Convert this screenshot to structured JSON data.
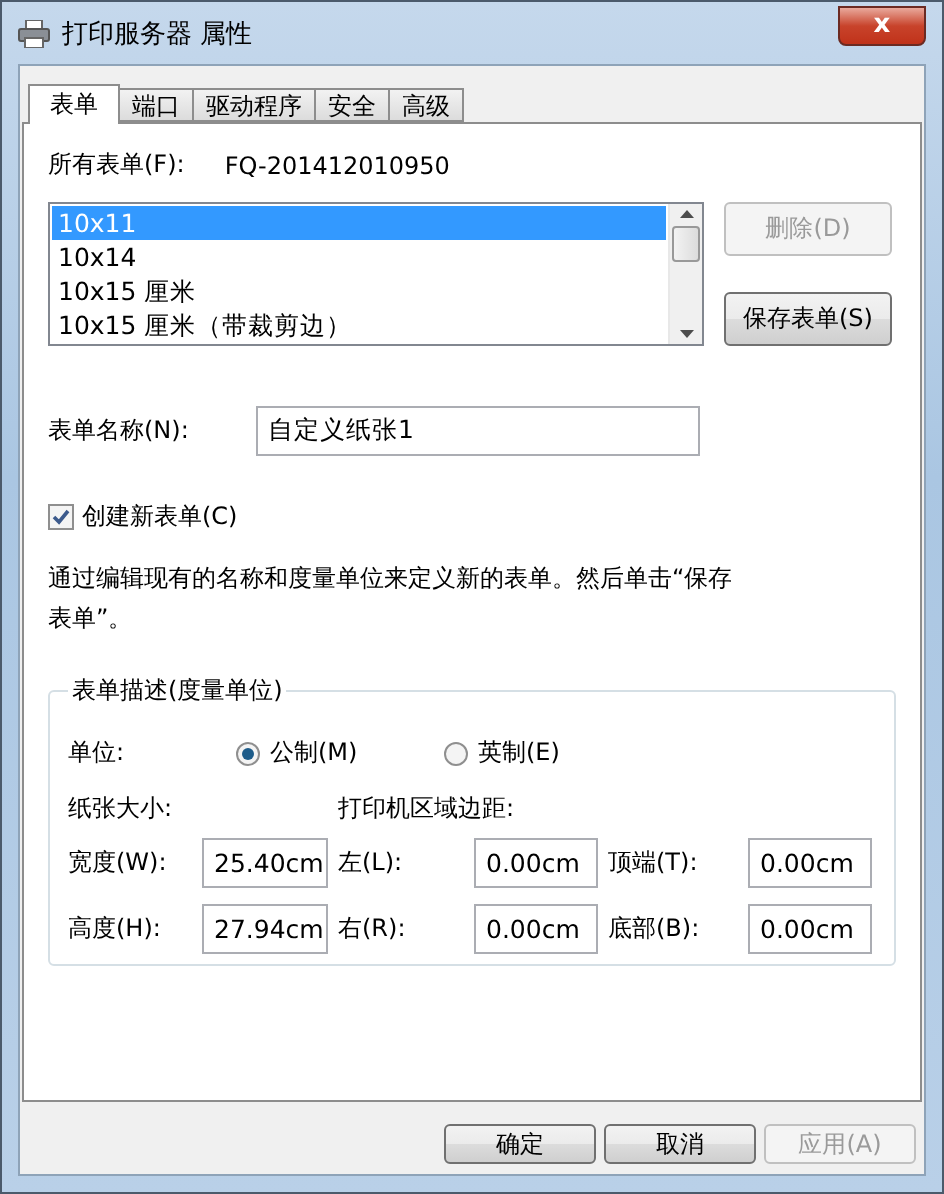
{
  "window": {
    "title": "打印服务器 属性",
    "close": "x"
  },
  "tabs": [
    {
      "label": "表单",
      "selected": true
    },
    {
      "label": "端口",
      "selected": false
    },
    {
      "label": "驱动程序",
      "selected": false
    },
    {
      "label": "安全",
      "selected": false
    },
    {
      "label": "高级",
      "selected": false
    }
  ],
  "all_forms": {
    "label": "所有表单(F):",
    "server": "FQ-201412010950"
  },
  "form_list": [
    {
      "label": "10x11",
      "selected": true
    },
    {
      "label": "10x14",
      "selected": false
    },
    {
      "label": "10x15 厘米",
      "selected": false
    },
    {
      "label": "10x15 厘米（带裁剪边）",
      "selected": false
    }
  ],
  "side_buttons": [
    {
      "label": "删除(D)",
      "disabled": true
    },
    {
      "label": "保存表单(S)",
      "disabled": false
    }
  ],
  "form_name": {
    "label": "表单名称(N):",
    "value": "自定义纸张1"
  },
  "create_new": {
    "label": "创建新表单(C)",
    "checked": true
  },
  "hint": "通过编辑现有的名称和度量单位来定义新的表单。然后单击“保存表单”。",
  "description": {
    "title": "表单描述(度量单位)",
    "units_label": "单位:",
    "units": [
      {
        "label": "公制(M)",
        "selected": true
      },
      {
        "label": "英制(E)",
        "selected": false
      }
    ],
    "paper_size_label": "纸张大小:",
    "margins_label": "打印机区域边距:",
    "rows": [
      [
        {
          "label": "宽度(W):",
          "value": "25.40cm"
        },
        {
          "label": "左(L):",
          "value": "0.00cm"
        },
        {
          "label": "顶端(T):",
          "value": "0.00cm"
        }
      ],
      [
        {
          "label": "高度(H):",
          "value": "27.94cm"
        },
        {
          "label": "右(R):",
          "value": "0.00cm"
        },
        {
          "label": "底部(B):",
          "value": "0.00cm"
        }
      ]
    ]
  },
  "buttons": [
    {
      "label": "确定",
      "disabled": false
    },
    {
      "label": "取消",
      "disabled": false
    },
    {
      "label": "应用(A)",
      "disabled": true
    }
  ]
}
